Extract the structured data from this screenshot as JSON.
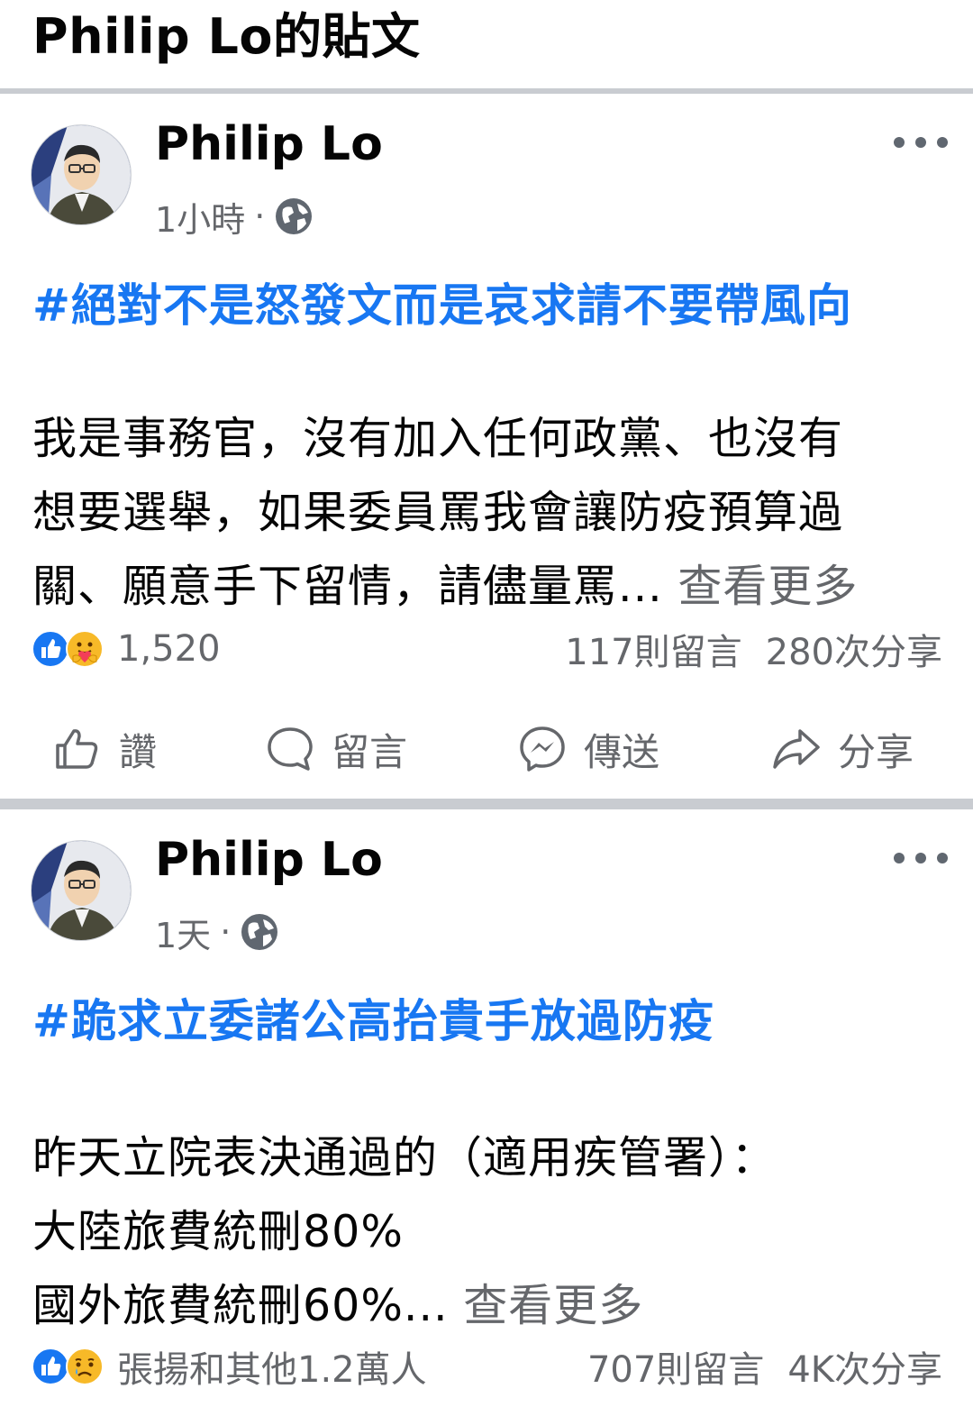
{
  "page": {
    "title": "Philip Lo的貼文"
  },
  "colors": {
    "link": "#1877f2",
    "secondary_text": "#65676b",
    "separator": "#c9ccd1"
  },
  "posts": [
    {
      "author": "Philip Lo",
      "time": "1小時",
      "dot": "·",
      "privacy_icon": "globe-icon",
      "hashtag": "#絕對不是怒發文而是哀求請不要帶風向",
      "lines": [
        "我是事務官，沒有加入任何政黨、也沒有",
        "想要選舉，如果委員罵我會讓防疫預算過",
        "關、願意手下留情，請儘量罵..."
      ],
      "see_more": "查看更多",
      "reactions": [
        "like-icon",
        "care-icon"
      ],
      "reaction_count": "1,520",
      "comments": "117則留言",
      "shares": "280次分享",
      "actions": {
        "like": "讚",
        "comment": "留言",
        "send": "傳送",
        "share": "分享"
      }
    },
    {
      "author": "Philip Lo",
      "time": "1天",
      "dot": "·",
      "privacy_icon": "globe-icon",
      "hashtag": "#跪求立委諸公高抬貴手放過防疫",
      "lines": [
        "昨天立院表決通過的（適用疾管署）：",
        "大陸旅費統刪80%",
        "國外旅費統刪60%..."
      ],
      "see_more": "查看更多",
      "reactions": [
        "like-icon",
        "sad-icon"
      ],
      "reaction_count": "張揚和其他1.2萬人",
      "comments": "707則留言",
      "shares": "4K次分享"
    }
  ]
}
